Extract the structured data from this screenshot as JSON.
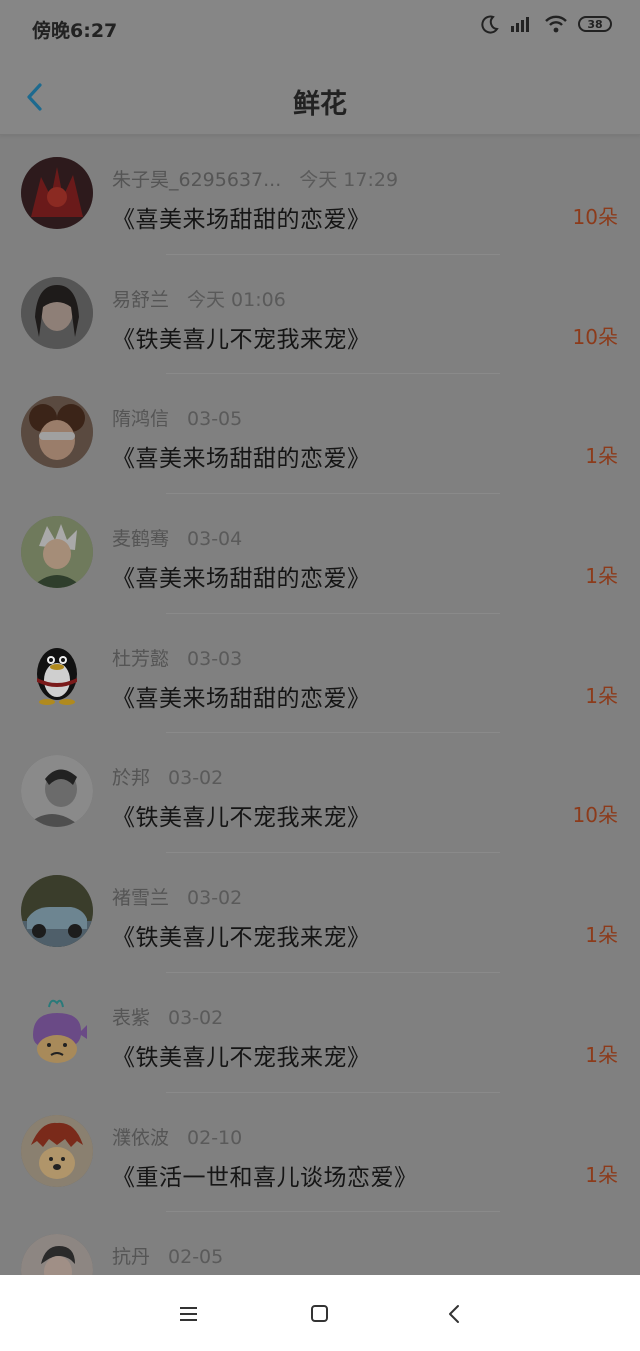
{
  "status": {
    "time": "傍晚6:27",
    "battery": "38"
  },
  "header": {
    "title": "鲜花"
  },
  "items": [
    {
      "name": "朱子昊_6295637...",
      "date": "今天 17:29",
      "book": "《喜美来场甜甜的恋爱》",
      "count": "10朵",
      "avatar_color": "#5b1e1e"
    },
    {
      "name": "易舒兰",
      "date": "今天 01:06",
      "book": "《铁美喜儿不宠我来宠》",
      "count": "10朵",
      "avatar_color": "#6f5f5a"
    },
    {
      "name": "隋鸿信",
      "date": "03-05",
      "book": "《喜美来场甜甜的恋爱》",
      "count": "1朵",
      "avatar_color": "#6b4a36"
    },
    {
      "name": "麦鹤骞",
      "date": "03-04",
      "book": "《喜美来场甜甜的恋爱》",
      "count": "1朵",
      "avatar_color": "#6a7451"
    },
    {
      "name": "杜芳懿",
      "date": "03-03",
      "book": "《喜美来场甜甜的恋爱》",
      "count": "1朵",
      "avatar_color": "#808080"
    },
    {
      "name": "於邦",
      "date": "03-02",
      "book": "《铁美喜儿不宠我来宠》",
      "count": "10朵",
      "avatar_color": "#6e6e6e"
    },
    {
      "name": "褚雪兰",
      "date": "03-02",
      "book": "《铁美喜儿不宠我来宠》",
      "count": "1朵",
      "avatar_color": "#4e4f3c"
    },
    {
      "name": "表紫",
      "date": "03-02",
      "book": "《铁美喜儿不宠我来宠》",
      "count": "1朵",
      "avatar_color": "#808080"
    },
    {
      "name": "濮依波",
      "date": "02-10",
      "book": "《重活一世和喜儿谈场恋爱》",
      "count": "1朵",
      "avatar_color": "#7a5b3b"
    },
    {
      "name": "抗丹",
      "date": "02-05",
      "book": "",
      "count": "",
      "avatar_color": "#8a8480"
    }
  ]
}
